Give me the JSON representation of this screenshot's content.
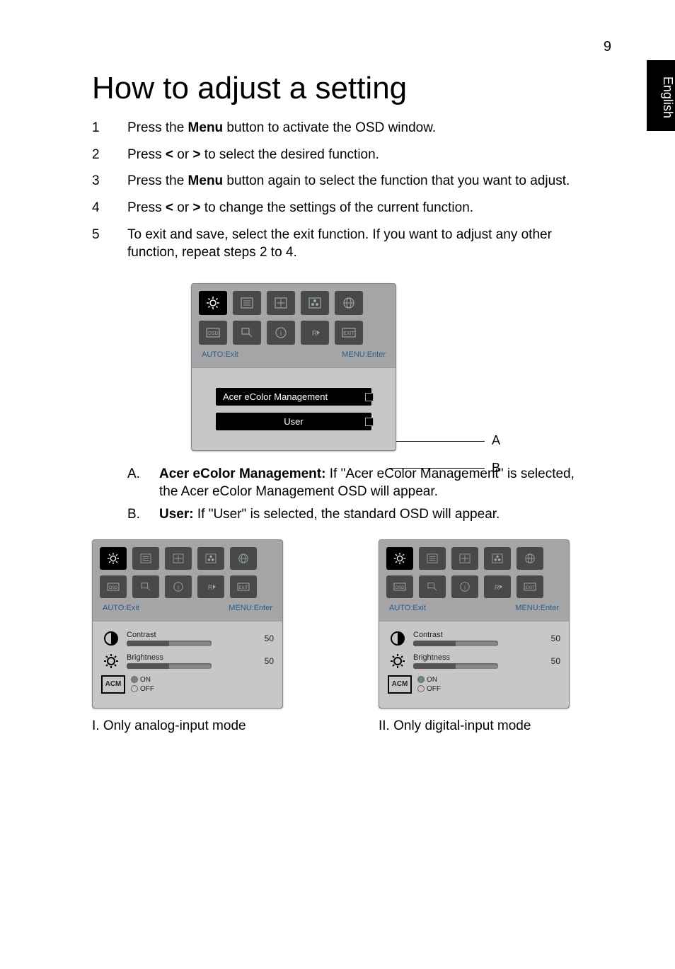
{
  "page_number": "9",
  "side_tab": "English",
  "title": "How to adjust a setting",
  "steps": [
    {
      "num": "1",
      "pre": "Press the ",
      "bold": "Menu",
      "post": " button to activate the OSD window."
    },
    {
      "num": "2",
      "pre": "Press ",
      "bold": "<",
      "mid": " or ",
      "bold2": ">",
      "post": " to select the desired function."
    },
    {
      "num": "3",
      "pre": "Press the ",
      "bold": "Menu",
      "post": " button again to select the function that you want to adjust."
    },
    {
      "num": "4",
      "pre": "Press ",
      "bold": "<",
      "mid": " or ",
      "bold2": ">",
      "post": " to change the settings of the current function."
    },
    {
      "num": "5",
      "pre": "",
      "post": "To exit and save, select the exit function. If you want to adjust any other function, repeat steps 2 to 4."
    }
  ],
  "osd_main": {
    "hint_left": "AUTO:Exit",
    "hint_right": "MENU:Enter",
    "menu_item_a": "Acer eColor Management",
    "menu_item_b": "User",
    "label_a": "A",
    "label_b": "B"
  },
  "notes": {
    "a": {
      "lbl": "A.",
      "bold": "Acer eColor Management:",
      "txt": " If \"Acer eColor Management\" is selected, the Acer eColor Management OSD will appear."
    },
    "b": {
      "lbl": "B.",
      "bold": "User:",
      "txt": " If \"User\" is selected, the standard OSD will appear."
    }
  },
  "user_panel": {
    "hint_left": "AUTO:Exit",
    "hint_right": "MENU:Enter",
    "contrast_label": "Contrast",
    "contrast_value": "50",
    "brightness_label": "Brightness",
    "brightness_value": "50",
    "acm_label": "ACM",
    "acm_on": "ON",
    "acm_off": "OFF"
  },
  "captions": {
    "left": "I. Only analog-input mode",
    "right": "II. Only digital-input mode"
  },
  "icons": {
    "sun": "sun-icon",
    "list": "list-icon",
    "position": "position-icon",
    "color": "color-icon",
    "globe": "globe-icon",
    "osd": "osd-icon",
    "signal": "signal-icon",
    "info": "info-icon",
    "reset": "reset-icon",
    "exit": "exit-icon",
    "contrast": "contrast-icon",
    "brightness": "brightness-icon"
  }
}
